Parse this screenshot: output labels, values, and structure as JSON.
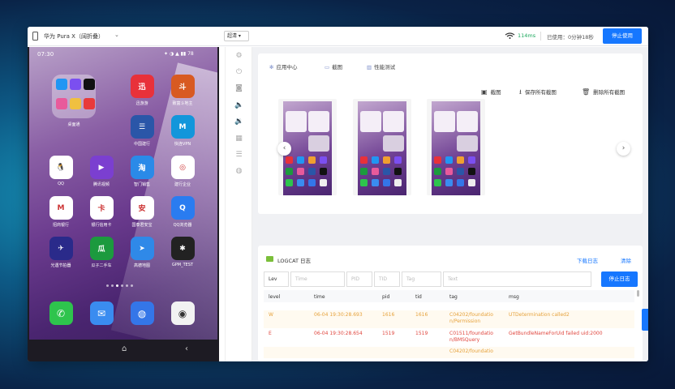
{
  "topbar": {
    "device_name": "华为 Pura X（阔折叠）",
    "quality": "超清 ▾",
    "latency": "114ms",
    "used_time": "已使用：0分钟18秒",
    "stop_button": "停止使用"
  },
  "phone": {
    "time": "07:30",
    "status_icons": "✦ ◑ ▲ ▮▮ 78",
    "folder_label": "桌面通",
    "apps": [
      {
        "label": "迅游游",
        "color": "#e8313a",
        "glyph": "迅"
      },
      {
        "label": "致富斗地主",
        "color": "#d85a22",
        "glyph": "斗"
      },
      {
        "label": "中国建行",
        "color": "#2a56a8",
        "glyph": "☰"
      },
      {
        "label": "快连VPN",
        "color": "#1296db",
        "glyph": "M"
      },
      {
        "label": "QQ",
        "color": "#ffffff",
        "glyph": "🐧"
      },
      {
        "label": "腾讯视频",
        "color": "#7b3fd0",
        "glyph": "▶"
      },
      {
        "label": "智门销售",
        "color": "#2a8ae8",
        "glyph": "淘"
      },
      {
        "label": "建行企业",
        "color": "#ffffff",
        "glyph": "◎"
      },
      {
        "label": "招商银行",
        "color": "#ffffff",
        "glyph": "M"
      },
      {
        "label": "银行信用卡",
        "color": "#ffffff",
        "glyph": "卡"
      },
      {
        "label": "国泰君安宝",
        "color": "#ffffff",
        "glyph": "安"
      },
      {
        "label": "QQ浏览器",
        "color": "#2a7cf0",
        "glyph": "Q"
      },
      {
        "label": "光遇节拍器",
        "color": "#2a2a8a",
        "glyph": "✈"
      },
      {
        "label": "瓜子二手车",
        "color": "#1c9a3e",
        "glyph": "瓜"
      },
      {
        "label": "高德地图",
        "color": "#2f89e8",
        "glyph": "➤"
      },
      {
        "label": "GPM_TEST",
        "color": "#222222",
        "glyph": "✱"
      }
    ],
    "dock": [
      {
        "label": "phone-app",
        "color": "#2ec44d",
        "glyph": "✆"
      },
      {
        "label": "messages-app",
        "color": "#3a8cf0",
        "glyph": "✉"
      },
      {
        "label": "browser-app",
        "color": "#3476e8",
        "glyph": "◍"
      },
      {
        "label": "camera-app",
        "color": "#f2f2f2",
        "glyph": "◉"
      }
    ]
  },
  "screenshots_panel": {
    "tabs": [
      "应用中心",
      "截图",
      "性能测试"
    ],
    "actions": [
      "截图",
      "保存所有截图",
      "删除所有截图"
    ],
    "thumbnail_count": 3
  },
  "logcat": {
    "title": "LOGCAT 日志",
    "download": "下载日志",
    "clear": "清除",
    "filters": {
      "level": "Lev",
      "time": "Time",
      "pid": "PID",
      "tid": "TID",
      "tag": "Tag",
      "text": "Text"
    },
    "stop_button": "停止日志",
    "columns": [
      "level",
      "time",
      "pid",
      "tid",
      "tag",
      "msg"
    ],
    "rows": [
      {
        "level": "W",
        "time": "06-04 19:30:28.693",
        "pid": "1616",
        "tid": "1616",
        "tag": "C04202/foundatio n/Permission",
        "msg": "UTDetermination called2",
        "kind": "warn"
      },
      {
        "level": "E",
        "time": "06-04 19:30:28.654",
        "pid": "1519",
        "tid": "1519",
        "tag": "C01511/foundatio n/BMSQuery",
        "msg": "GetBundleNameForUid failed uid:2000",
        "kind": "err"
      },
      {
        "level": "",
        "time": "",
        "pid": "",
        "tid": "",
        "tag": "C04202/foundatio",
        "msg": "",
        "kind": "warn"
      }
    ]
  },
  "colors": {
    "accent": "#1677ff",
    "warn": "#e6a23c",
    "error": "#e0463e",
    "latency": "#1aa85c"
  }
}
